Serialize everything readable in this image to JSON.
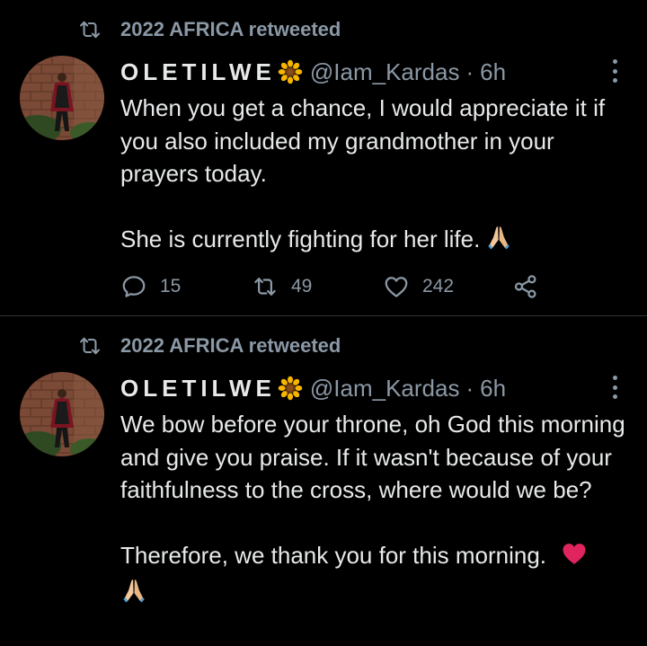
{
  "colors": {
    "background": "#000000",
    "primary_text": "#e7e9ea",
    "secondary_text": "#8b98a5",
    "divider": "#2f3336",
    "heart": "#e0245e"
  },
  "tweets": [
    {
      "retweeted_by": "2022 AFRICA retweeted",
      "display_name": "OLETILWE",
      "handle": "@Iam_Kardas",
      "separator": "·",
      "time": "6h",
      "paragraphs": [
        "When you get a chance, I would appreciate it if you also included my grandmother in your prayers today.",
        "She is currently fighting for her life."
      ],
      "trailing_emoji": "folded-hands",
      "actions": {
        "replies": "15",
        "retweets": "49",
        "likes": "242"
      },
      "icons": [
        "retweet-icon",
        "sunflower-icon",
        "more-icon",
        "reply-icon",
        "retweet-icon",
        "like-icon",
        "share-icon"
      ]
    },
    {
      "retweeted_by": "2022 AFRICA retweeted",
      "display_name": "OLETILWE",
      "handle": "@Iam_Kardas",
      "separator": "·",
      "time": "6h",
      "paragraphs": [
        "We bow before your throne, oh God this morning and give you praise. If it wasn't because of your faithfulness to the cross, where would we be?",
        "Therefore, we thank you for this morning."
      ],
      "trailing_emoji": "red-heart, folded-hands",
      "icons": [
        "retweet-icon",
        "sunflower-icon",
        "more-icon"
      ]
    }
  ]
}
